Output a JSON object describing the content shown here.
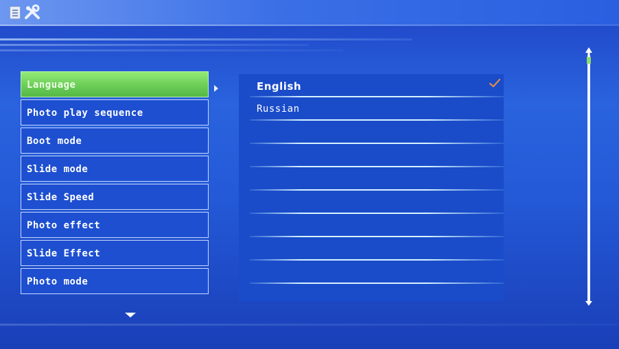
{
  "header": {
    "doc_icon": "document-icon",
    "tools_icon": "tools-icon"
  },
  "menu": {
    "items": [
      {
        "label": "Language",
        "selected": true
      },
      {
        "label": "Photo play sequence",
        "selected": false
      },
      {
        "label": "Boot mode",
        "selected": false
      },
      {
        "label": "Slide mode",
        "selected": false
      },
      {
        "label": "Slide Speed",
        "selected": false
      },
      {
        "label": "Photo effect",
        "selected": false
      },
      {
        "label": "Slide Effect",
        "selected": false
      },
      {
        "label": "Photo mode",
        "selected": false
      }
    ]
  },
  "options": {
    "items": [
      {
        "label": "English",
        "checked": true
      },
      {
        "label": "Russian",
        "checked": false
      },
      {
        "label": "",
        "checked": false
      },
      {
        "label": "",
        "checked": false
      },
      {
        "label": "",
        "checked": false
      },
      {
        "label": "",
        "checked": false
      },
      {
        "label": "",
        "checked": false
      },
      {
        "label": "",
        "checked": false
      },
      {
        "label": "",
        "checked": false
      }
    ]
  },
  "colors": {
    "selected_menu": "#6ccd57",
    "check": "#e38a4a",
    "background": "#245ad8"
  }
}
